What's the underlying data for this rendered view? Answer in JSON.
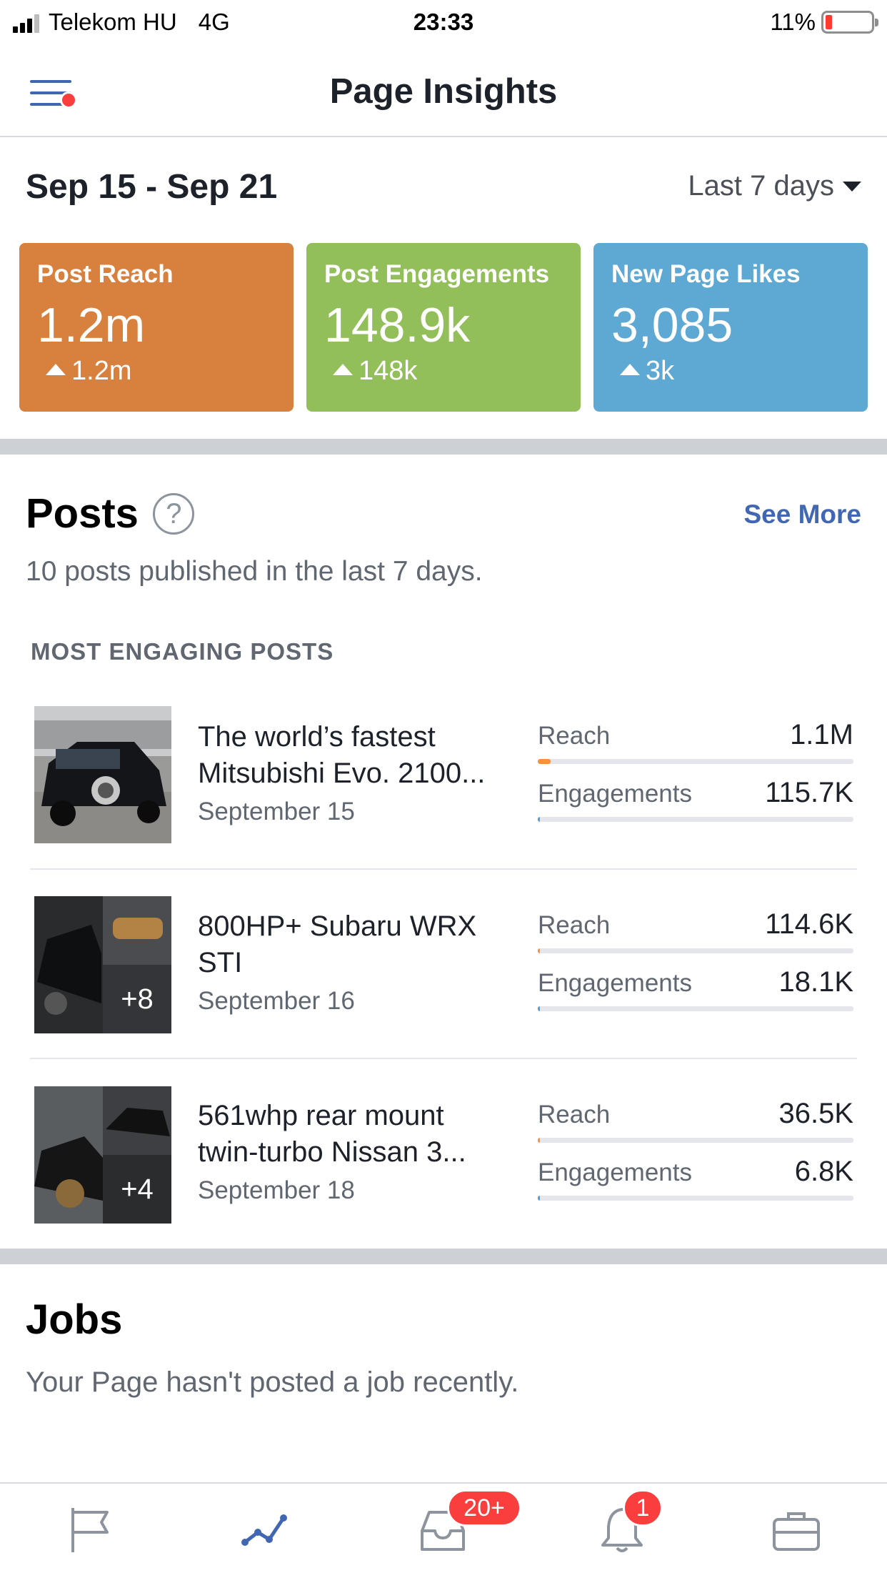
{
  "status_bar": {
    "carrier": "Telekom HU",
    "network": "4G",
    "time": "23:33",
    "battery": "11%",
    "battery_level": 0.11
  },
  "nav": {
    "title": "Page Insights",
    "menu_icon": "hamburger-menu-icon"
  },
  "summary": {
    "date_range": "Sep 15 - Sep 21",
    "period": "Last 7 days",
    "cards": [
      {
        "label": "Post Reach",
        "value": "1.2m",
        "delta": "1.2m",
        "color": "#d8803d"
      },
      {
        "label": "Post Engagements",
        "value": "148.9k",
        "delta": "148k",
        "color": "#93bf5b"
      },
      {
        "label": "New Page Likes",
        "value": "3,085",
        "delta": "3k",
        "color": "#5da9d3"
      }
    ]
  },
  "posts": {
    "title": "Posts",
    "see_more": "See More",
    "subtitle": "10 posts published in the last 7 days.",
    "section_label": "MOST ENGAGING POSTS",
    "reach_label": "Reach",
    "engagements_label": "Engagements",
    "items": [
      {
        "title": "The world’s fastest Mitsubishi Evo. 2100...",
        "date": "September 15",
        "reach": "1.1M",
        "engagements": "115.7K",
        "reach_fraction": 0.04,
        "engagement_fraction": 0.006,
        "extra_photos": ""
      },
      {
        "title": "800HP+ Subaru WRX STI",
        "date": "September 16",
        "reach": "114.6K",
        "engagements": "18.1K",
        "reach_fraction": 0.004,
        "engagement_fraction": 0.001,
        "extra_photos": "+8"
      },
      {
        "title": "561whp rear mount twin-turbo Nissan 3...",
        "date": "September 18",
        "reach": "36.5K",
        "engagements": "6.8K",
        "reach_fraction": 0.002,
        "engagement_fraction": 0.0005,
        "extra_photos": "+4"
      }
    ]
  },
  "jobs": {
    "title": "Jobs",
    "text": "Your Page hasn't posted a job recently."
  },
  "tab_bar": {
    "tabs": [
      "flag-icon",
      "insights-icon",
      "inbox-icon",
      "notifications-icon",
      "briefcase-icon"
    ],
    "inbox_badge": "20+",
    "notifications_badge": "1"
  }
}
